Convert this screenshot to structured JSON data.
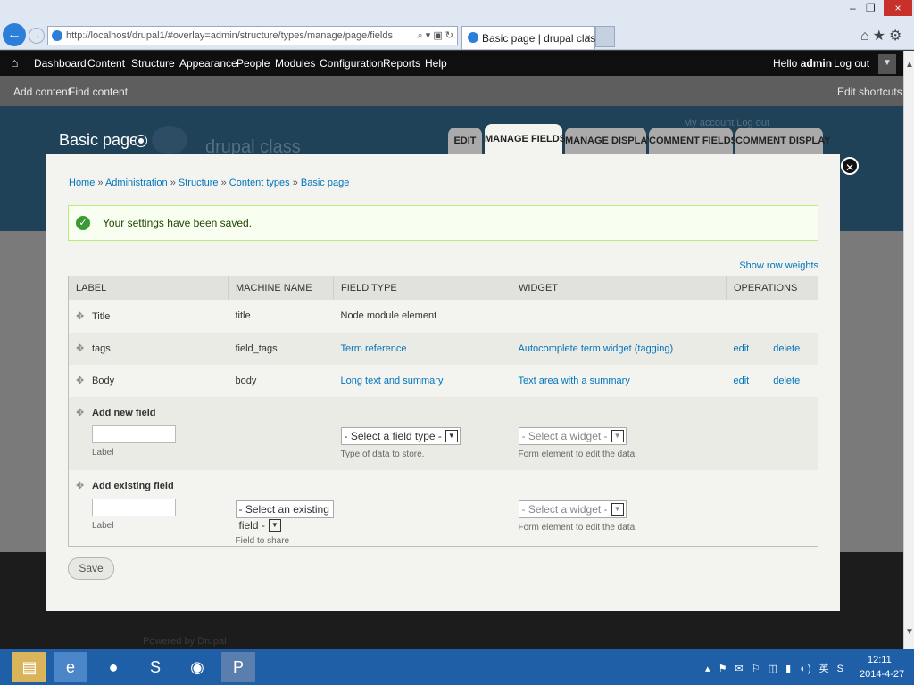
{
  "browser": {
    "back_glyph": "←",
    "fwd_glyph": "→",
    "address": "http://localhost/drupal1/#overlay=admin/structure/types/manage/page/fields",
    "address_tools": "⌕ ▾ ▣ ↻",
    "tab_title": "Basic page | drupal class",
    "tab_close": "×",
    "window_controls": {
      "min": "–",
      "restore": "❐",
      "close": "×"
    },
    "right_icons": "⌂★⚙"
  },
  "toolbar": {
    "home_glyph": "⌂",
    "items": [
      "Dashboard",
      "Content",
      "Structure",
      "Appearance",
      "People",
      "Modules",
      "Configuration",
      "Reports",
      "Help"
    ],
    "hello_prefix": "Hello ",
    "user": "admin",
    "logout": "Log out",
    "toggle_glyph": "▼"
  },
  "shortcuts": {
    "add_content": "Add content",
    "find_content": "Find content",
    "edit_shortcuts": "Edit shortcuts"
  },
  "site": {
    "name": "drupal class",
    "user_links": "My account    Log out",
    "powered": "Powered by Drupal"
  },
  "page": {
    "title": "Basic page",
    "tabs": [
      "EDIT",
      "MANAGE FIELDS",
      "MANAGE DISPLAY",
      "COMMENT FIELDS",
      "COMMENT DISPLAY"
    ],
    "active_tab": "MANAGE FIELDS"
  },
  "overlay": {
    "close_glyph": "✕",
    "breadcrumb": [
      "Home",
      "Administration",
      "Structure",
      "Content types",
      "Basic page"
    ],
    "breadcrumb_sep": " » ",
    "message_icon": "✓",
    "message": "Your settings have been saved.",
    "row_weights": "Show row weights",
    "columns": [
      "LABEL",
      "MACHINE NAME",
      "FIELD TYPE",
      "WIDGET",
      "OPERATIONS"
    ],
    "rows": [
      {
        "label": "Title",
        "machine": "title",
        "type": "Node module element",
        "widget": "",
        "edit": "",
        "delete": ""
      },
      {
        "label": "tags",
        "machine": "field_tags",
        "type": "Term reference",
        "widget": "Autocomplete term widget (tagging)",
        "edit": "edit",
        "delete": "delete"
      },
      {
        "label": "Body",
        "machine": "body",
        "type": "Long text and summary",
        "widget": "Text area with a summary",
        "edit": "edit",
        "delete": "delete"
      }
    ],
    "add_new": {
      "title": "Add new field",
      "label_hint": "Label",
      "type_select": "- Select a field type -",
      "type_hint": "Type of data to store.",
      "widget_select": "- Select a widget -",
      "widget_hint": "Form element to edit the data."
    },
    "add_existing": {
      "title": "Add existing field",
      "label_hint": "Label",
      "field_select": "- Select an existing field -",
      "field_hint": "Field to share",
      "widget_select": "- Select a widget -",
      "widget_hint": "Form element to edit the data."
    },
    "save": "Save"
  },
  "taskbar": {
    "tray": "▴ ⚑ ✉ ⚐ ◫ ▮ ◖) 英 S",
    "time": "12:11",
    "date": "2014-4-27"
  },
  "colors": {
    "toolbar": "#0f0f0f",
    "header": "#1f4259",
    "link": "#0074bd",
    "taskbar": "#1f5fa8"
  }
}
